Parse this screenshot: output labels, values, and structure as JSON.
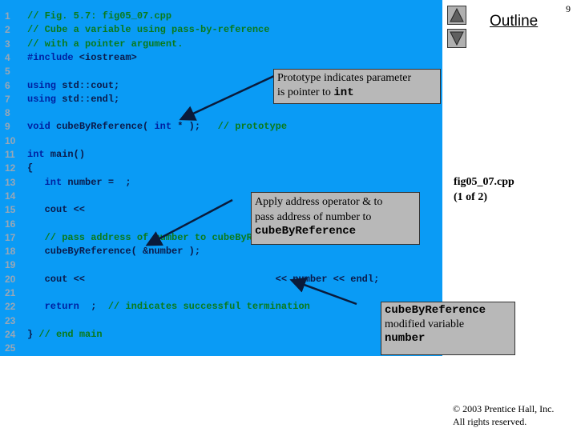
{
  "page_number": "9",
  "outline_label": "Outline",
  "file_info": {
    "name": "fig05_07.cpp",
    "part": "(1 of 2)"
  },
  "copyright": {
    "line1": "© 2003 Prentice Hall, Inc.",
    "line2": "All rights reserved."
  },
  "colors": {
    "code_bg": "#0a9bf5",
    "keyword": "#0020a0",
    "comment": "#0a7a1a",
    "callout_bg": "#b8b8b8"
  },
  "icons": {
    "up": "triangle-up-icon",
    "down": "triangle-down-icon"
  },
  "code_lines": [
    {
      "n": "1",
      "segs": [
        {
          "t": "// Fig. 5.7: fig05_07.cpp",
          "k": "cm"
        }
      ]
    },
    {
      "n": "2",
      "segs": [
        {
          "t": "// Cube a variable using pass-by-reference",
          "k": "cm"
        }
      ]
    },
    {
      "n": "3",
      "segs": [
        {
          "t": "// with a pointer argument.",
          "k": "cm"
        }
      ]
    },
    {
      "n": "4",
      "segs": [
        {
          "t": "#include",
          "k": "kw"
        },
        {
          "t": " <iostream>",
          "k": ""
        }
      ]
    },
    {
      "n": "5",
      "segs": []
    },
    {
      "n": "6",
      "segs": [
        {
          "t": "using",
          "k": "kw"
        },
        {
          "t": " std::cout;",
          "k": ""
        }
      ]
    },
    {
      "n": "7",
      "segs": [
        {
          "t": "using",
          "k": "kw"
        },
        {
          "t": " std::endl;",
          "k": ""
        }
      ]
    },
    {
      "n": "8",
      "segs": []
    },
    {
      "n": "9",
      "segs": [
        {
          "t": "void",
          "k": "kw"
        },
        {
          "t": " cubeByReference( ",
          "k": ""
        },
        {
          "t": "int",
          "k": "kw"
        },
        {
          "t": " * );   ",
          "k": ""
        },
        {
          "t": "// prototype",
          "k": "cm"
        }
      ]
    },
    {
      "n": "10",
      "segs": []
    },
    {
      "n": "11",
      "segs": [
        {
          "t": "int",
          "k": "kw"
        },
        {
          "t": " main()",
          "k": ""
        }
      ]
    },
    {
      "n": "12",
      "segs": [
        {
          "t": "{",
          "k": ""
        }
      ]
    },
    {
      "n": "13",
      "segs": [
        {
          "t": "   ",
          "k": ""
        },
        {
          "t": "int",
          "k": "kw"
        },
        {
          "t": " number =  ;",
          "k": ""
        }
      ]
    },
    {
      "n": "14",
      "segs": []
    },
    {
      "n": "15",
      "segs": [
        {
          "t": "   cout <<",
          "k": ""
        }
      ]
    },
    {
      "n": "16",
      "segs": []
    },
    {
      "n": "17",
      "segs": [
        {
          "t": "   // pass address of number to cubeByReference",
          "k": "cm"
        }
      ]
    },
    {
      "n": "18",
      "segs": [
        {
          "t": "   cubeByReference( &number );",
          "k": ""
        }
      ]
    },
    {
      "n": "19",
      "segs": []
    },
    {
      "n": "20",
      "segs": [
        {
          "t": "   cout <<                                 << number << endl;",
          "k": ""
        }
      ]
    },
    {
      "n": "21",
      "segs": []
    },
    {
      "n": "22",
      "segs": [
        {
          "t": "   ",
          "k": ""
        },
        {
          "t": "return",
          "k": "kw"
        },
        {
          "t": "  ;  ",
          "k": ""
        },
        {
          "t": "// indicates successful termination",
          "k": "cm"
        }
      ]
    },
    {
      "n": "23",
      "segs": []
    },
    {
      "n": "24",
      "segs": [
        {
          "t": "} ",
          "k": ""
        },
        {
          "t": "// end main",
          "k": "cm"
        }
      ]
    },
    {
      "n": "25",
      "segs": []
    }
  ],
  "callouts": {
    "prototype": {
      "text1": "Prototype indicates parameter",
      "text2": "is pointer to ",
      "code": "int"
    },
    "address": {
      "text1": "Apply address operator & to",
      "text2": "pass address of number to",
      "code": "cubeByReference"
    },
    "modified": {
      "code1": "cubeByReference",
      "text": "modified variable",
      "code2": "number"
    }
  }
}
